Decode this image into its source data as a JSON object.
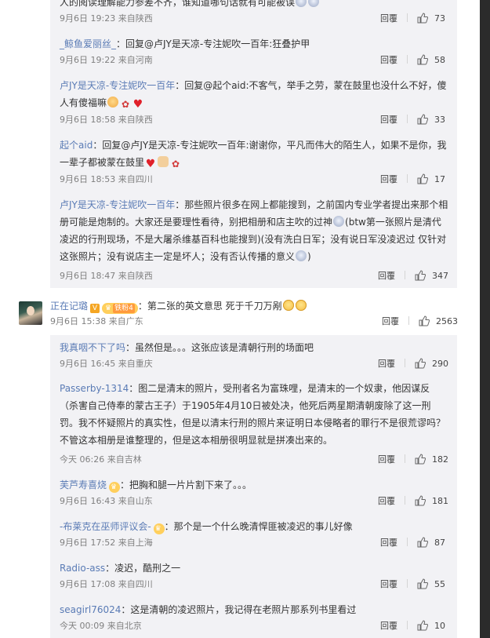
{
  "common": {
    "reply_label": "回覆"
  },
  "sub1": {
    "replies": [
      {
        "name": "",
        "text": "人的阅读理解能力参差不齐，谁知道哪句话就有可能被误",
        "time": "9月6日 19:23 来自陕西",
        "likes": "73"
      },
      {
        "name": "_鲸鱼爱丽丝_",
        "text": "：回复@卢JY是天凉-专注妮吹一百年:狂叠护甲",
        "time": "9月6日 19:22 来自河南",
        "likes": "58"
      },
      {
        "name": "卢JY是天凉-专注妮吹一百年",
        "text": "：回复@起个aid:不客气，举手之劳，蒙在鼓里也没什么不好，傻人有傻福嘛",
        "time": "9月6日 18:58 来自陕西",
        "likes": "33"
      },
      {
        "name": "起个aid",
        "text": "：回复@卢JY是天凉-专注妮吹一百年:谢谢你，平凡而伟大的陌生人，如果不是你，我一辈子都被蒙在鼓里",
        "time": "9月6日 18:53 来自四川",
        "likes": "17"
      },
      {
        "name": "卢JY是天凉-专注妮吹一百年",
        "text": "：那些照片很多在网上都能搜到，之前国内专业学者提出来那个相册可能是炮制的。大家还是要理性看待，别把相册和店主吹的过神",
        "text2": "(btw第一张照片是清代凌迟的行刑现场，不是大屠杀维基百科也能搜到)(没有洗白日军；没有说日军没凌迟过 仅针对这张照片；没有说店主一定是坏人；没有否认传播的意义",
        "text3": ")",
        "time": "9月6日 18:47 来自陕西",
        "likes": "347"
      }
    ]
  },
  "main_comment": {
    "name": "正在记璐",
    "fan_badge": "铁粉4",
    "text": "：第二张的英文意思 死于千刀万剐",
    "time": "9月6日 15:38 来自广东",
    "likes": "2563"
  },
  "sub2": {
    "replies": [
      {
        "name": "我真咽不下了吗",
        "text": "：虽然但是。。。这张应该是清朝行刑的场面吧",
        "time": "9月6日 16:45 来自重庆",
        "likes": "290"
      },
      {
        "name": "Passerby-1314",
        "text": "：图二是清末的照片，受刑者名为富珠哩，是清末的一个奴隶，他因谋反（杀害自己侍奉的蒙古王子）于1905年4月10日被处决，他死后两星期清朝废除了这一刑罚。我不怀疑照片的真实性，但是以清末行刑的照片来证明日本侵略者的罪行不是很荒谬吗？不管这本相册是谁整理的，但是这本相册很明显就是拼凑出来的。",
        "time": "今天 06:26 来自吉林",
        "likes": "182"
      },
      {
        "name": "芙芦寿喜烧",
        "text": "：把胸和腿一片片割下来了。。。",
        "time": "9月6日 16:43 来自山东",
        "likes": "181"
      },
      {
        "name": "-布莱克在巫师评议会-",
        "text": "：那个是一个什么晚清悍匪被凌迟的事儿好像",
        "time": "9月6日 17:52 来自上海",
        "likes": "87"
      },
      {
        "name": "Radio-ass",
        "text": "：凌迟，酷刑之一",
        "time": "9月6日 17:08 来自四川",
        "likes": "55"
      },
      {
        "name": "seagirl76024",
        "text": "：这是清朝的凌迟照片，我记得在老照片那系列书里看过",
        "time": "今天 00:09 来自北京",
        "likes": "10"
      }
    ]
  }
}
